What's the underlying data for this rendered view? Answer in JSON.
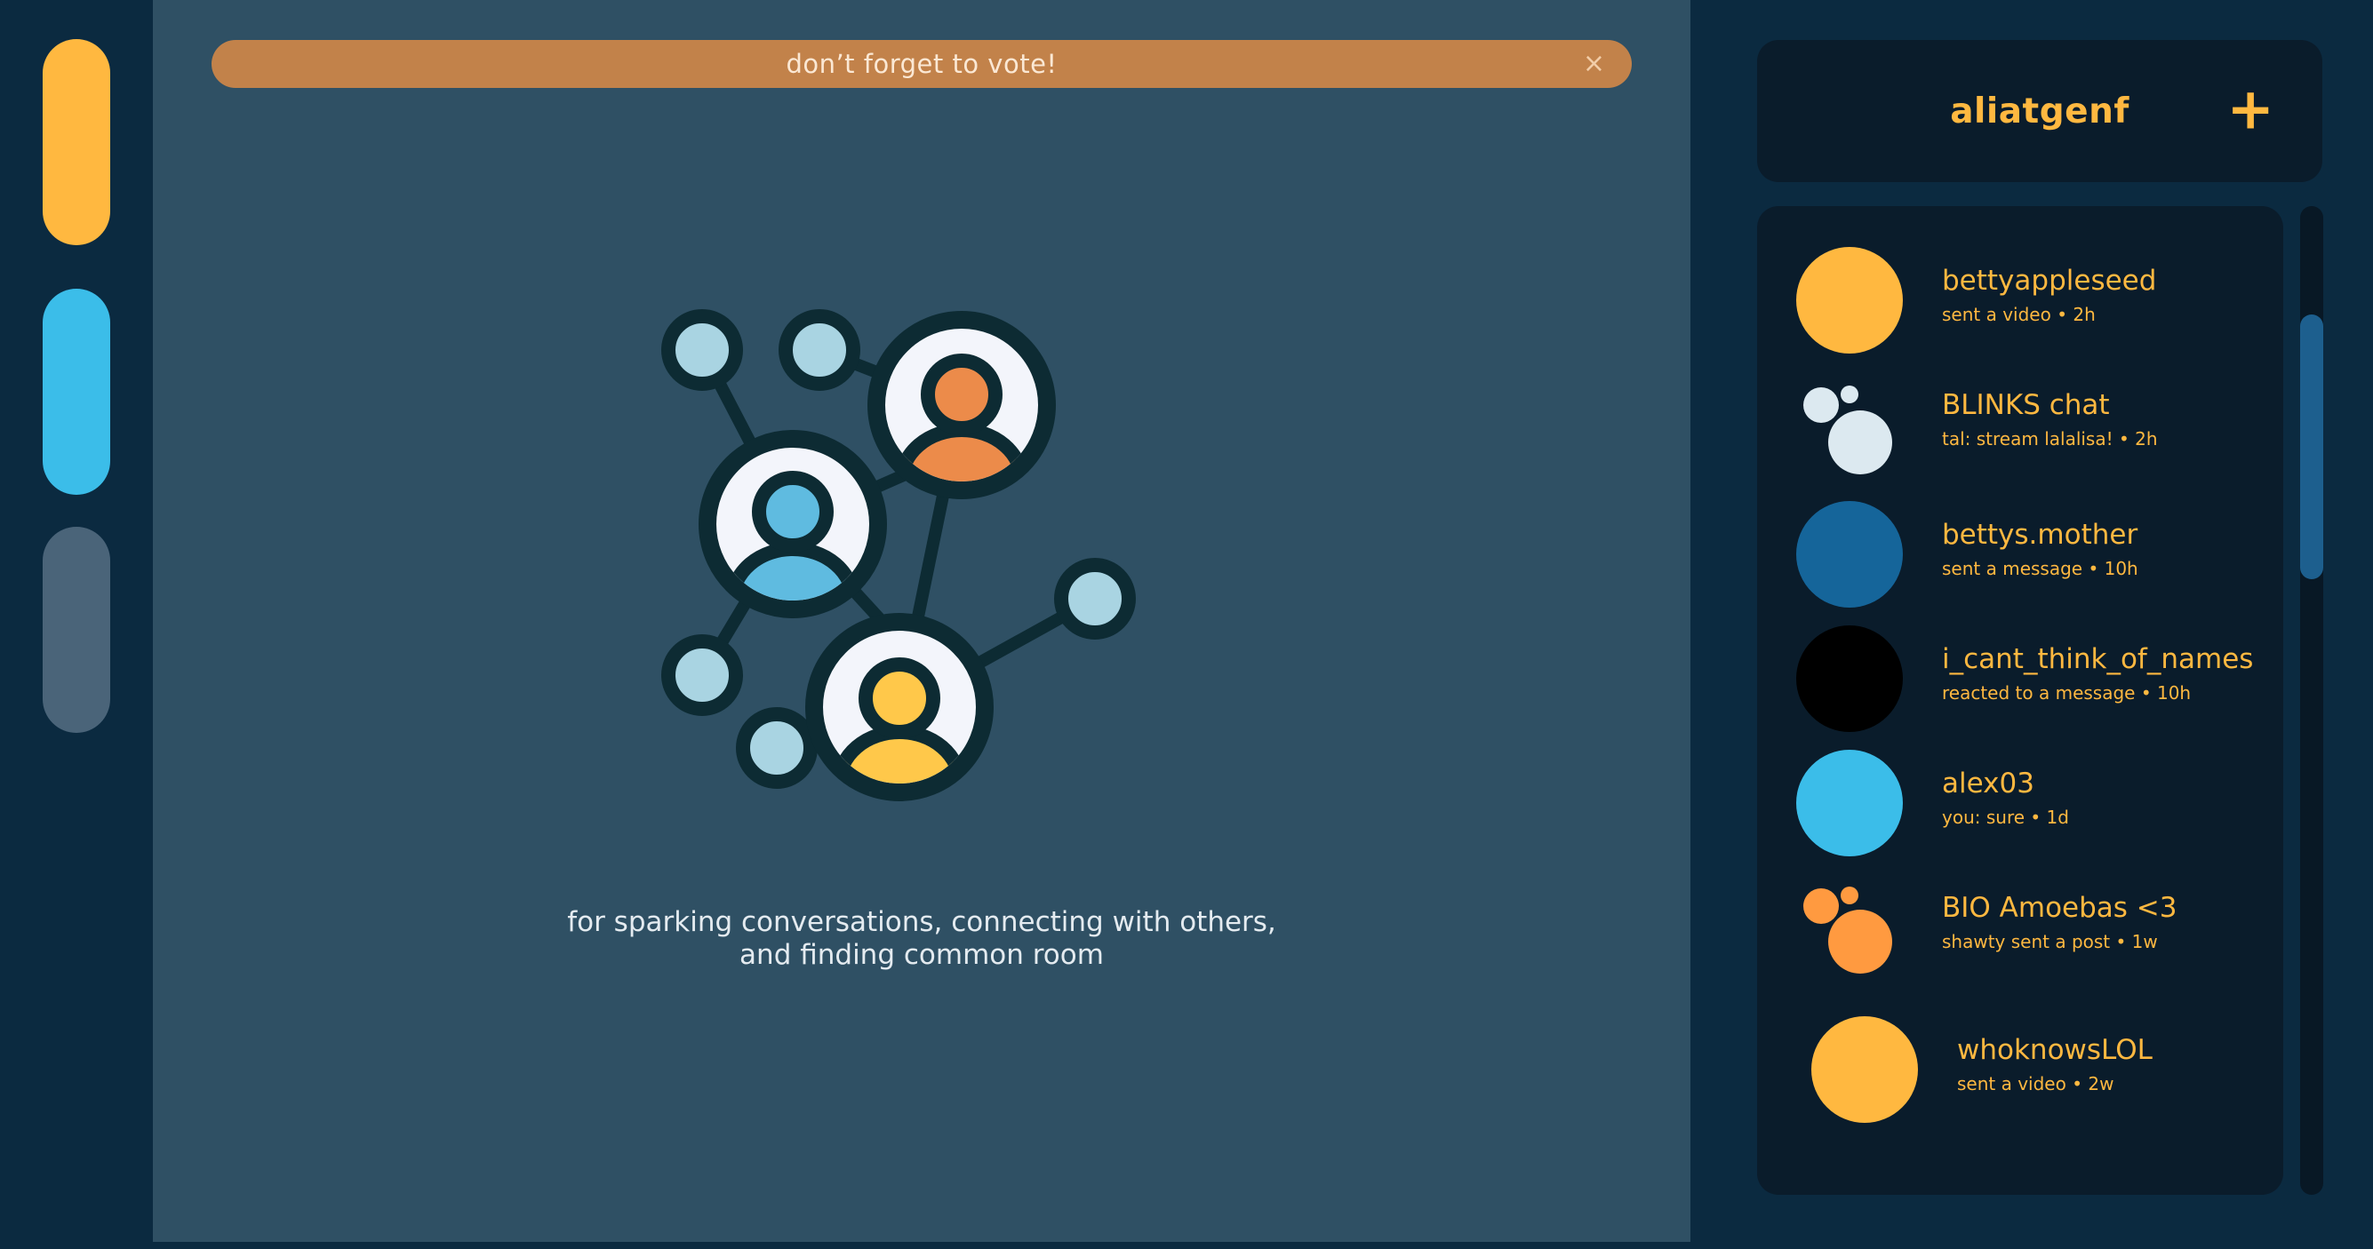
{
  "banner": {
    "text": "don’t forget to vote!",
    "close_icon": "×"
  },
  "rail": {
    "items": [
      {
        "name": "yellow-nav-pill",
        "color": "#ffb840"
      },
      {
        "name": "blue-nav-pill",
        "color": "#3bbde9"
      },
      {
        "name": "gray-nav-pill",
        "color": "#4a6479"
      }
    ]
  },
  "main": {
    "illustration_icon": "people-network-icon",
    "tagline_line1": "for sparking conversations, connecting with others,",
    "tagline_line2": "and finding common room"
  },
  "sidebar": {
    "username": "aliatgenf",
    "add_icon": "+",
    "chats": [
      {
        "name": "bettyappleseed",
        "sub": "sent a video • 2h",
        "avatar_color": "#ffb840",
        "avatar_type": "single"
      },
      {
        "name": "BLINKS chat",
        "sub": "tal: stream lalalisa! • 2h",
        "avatar_color": "#dce9f0",
        "avatar_type": "group"
      },
      {
        "name": "bettys.mother",
        "sub": "sent a message • 10h",
        "avatar_color": "#15659a",
        "avatar_type": "single"
      },
      {
        "name": "i_cant_think_of_names",
        "sub": "reacted to a message • 10h",
        "avatar_color": "#000000",
        "avatar_type": "single"
      },
      {
        "name": "alex03",
        "sub": "you: sure • 1d",
        "avatar_color": "#3bbde9",
        "avatar_type": "single"
      },
      {
        "name": "BIO Amoebas <3",
        "sub": "shawty sent a post • 1w",
        "avatar_color": "#ff9a40",
        "avatar_type": "group"
      },
      {
        "name": "whoknowsLOL",
        "sub": "sent a video • 2w",
        "avatar_color": "#ffb840",
        "avatar_type": "single"
      }
    ]
  },
  "colors": {
    "accent": "#ffb840",
    "banner": "#c2824a",
    "panel": "#2f5064",
    "background": "#0b2a40",
    "card": "#0a1c2b"
  }
}
